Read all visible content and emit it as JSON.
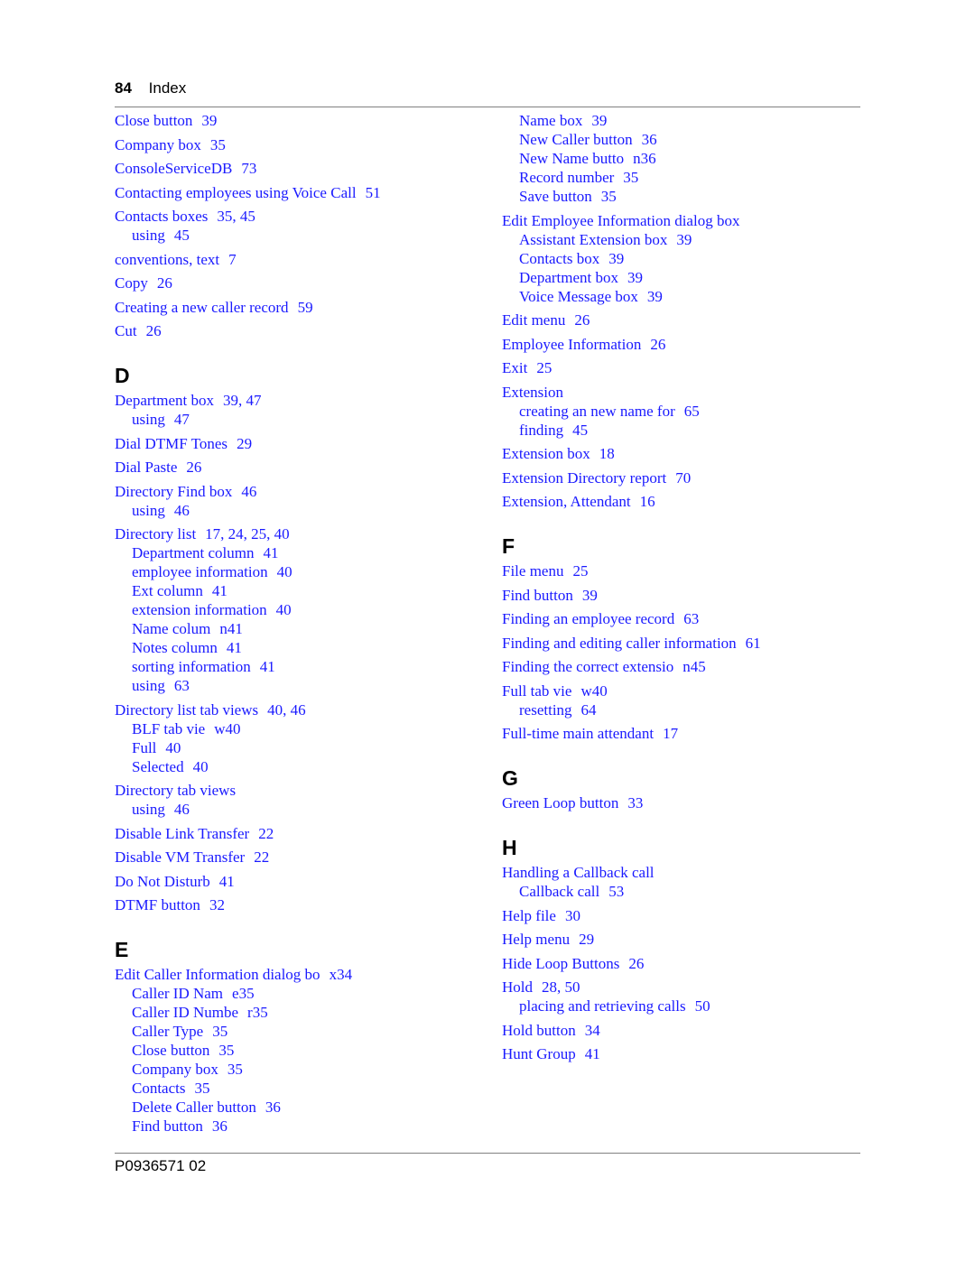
{
  "header": {
    "page_number": "84",
    "section": "Index"
  },
  "footer": {
    "doc_id": "P0936571 02"
  },
  "left_column": [
    {
      "type": "entry",
      "term": "Close button",
      "pages": "39"
    },
    {
      "type": "entry",
      "term": "Company box",
      "pages": "35"
    },
    {
      "type": "entry",
      "term": "ConsoleServiceDB",
      "pages": "73"
    },
    {
      "type": "entry",
      "term": "Contacting employees using Voice Call",
      "pages": "51"
    },
    {
      "type": "entry",
      "term": "Contacts boxes",
      "pages": "35, 45",
      "subs": [
        {
          "term": "using",
          "pages": "45"
        }
      ]
    },
    {
      "type": "entry",
      "term": "conventions, text",
      "pages": "7"
    },
    {
      "type": "entry",
      "term": "Copy",
      "pages": "26"
    },
    {
      "type": "entry",
      "term": "Creating a new caller record",
      "pages": "59"
    },
    {
      "type": "entry",
      "term": "Cut",
      "pages": "26"
    },
    {
      "type": "letter",
      "label": "D"
    },
    {
      "type": "entry",
      "term": "Department box",
      "pages": "39, 47",
      "subs": [
        {
          "term": "using",
          "pages": "47"
        }
      ]
    },
    {
      "type": "entry",
      "term": "Dial DTMF Tones",
      "pages": "29"
    },
    {
      "type": "entry",
      "term": "Dial Paste",
      "pages": "26"
    },
    {
      "type": "entry",
      "term": "Directory Find box",
      "pages": "46",
      "subs": [
        {
          "term": "using",
          "pages": "46"
        }
      ]
    },
    {
      "type": "entry",
      "term": "Directory list",
      "pages": "17, 24, 25, 40",
      "subs": [
        {
          "term": "Department column",
          "pages": "41"
        },
        {
          "term": "employee information",
          "pages": "40"
        },
        {
          "term": "Ext column",
          "pages": "41"
        },
        {
          "term": "extension information",
          "pages": "40"
        },
        {
          "term": "Name colum",
          "pages": "n41"
        },
        {
          "term": "Notes column",
          "pages": "41"
        },
        {
          "term": "sorting information",
          "pages": "41"
        },
        {
          "term": "using",
          "pages": "63"
        }
      ]
    },
    {
      "type": "entry",
      "term": "Directory list tab views",
      "pages": "40, 46",
      "subs": [
        {
          "term": "BLF tab vie",
          "pages": "w40"
        },
        {
          "term": "Full",
          "pages": "40"
        },
        {
          "term": "Selected",
          "pages": "40"
        }
      ]
    },
    {
      "type": "entry",
      "term": "Directory tab views",
      "pages": "",
      "subs": [
        {
          "term": "using",
          "pages": "46"
        }
      ]
    },
    {
      "type": "entry",
      "term": "Disable Link Transfer",
      "pages": "22"
    },
    {
      "type": "entry",
      "term": "Disable VM Transfer",
      "pages": "22"
    },
    {
      "type": "entry",
      "term": "Do Not Disturb",
      "pages": "41"
    },
    {
      "type": "entry",
      "term": "DTMF button",
      "pages": "32"
    },
    {
      "type": "letter",
      "label": "E"
    },
    {
      "type": "entry",
      "term": "Edit Caller Information dialog bo",
      "pages": "x34",
      "subs": [
        {
          "term": "Caller ID Nam",
          "pages": "e35"
        },
        {
          "term": "Caller ID Numbe",
          "pages": "r35"
        },
        {
          "term": "Caller Type",
          "pages": "35"
        },
        {
          "term": "Close button",
          "pages": "35"
        },
        {
          "term": "Company box",
          "pages": "35"
        },
        {
          "term": "Contacts",
          "pages": "35"
        },
        {
          "term": "Delete Caller button",
          "pages": "36"
        },
        {
          "term": "Find button",
          "pages": "36"
        }
      ]
    }
  ],
  "right_column": [
    {
      "type": "continuation",
      "subs": [
        {
          "term": "Name box",
          "pages": "39"
        },
        {
          "term": "New Caller button",
          "pages": "36"
        },
        {
          "term": "New Name butto",
          "pages": "n36"
        },
        {
          "term": "Record number",
          "pages": "35"
        },
        {
          "term": "Save button",
          "pages": "35"
        }
      ]
    },
    {
      "type": "entry",
      "term": "Edit Employee Information dialog box",
      "pages": "",
      "subs": [
        {
          "term": "Assistant Extension box",
          "pages": "39"
        },
        {
          "term": "Contacts box",
          "pages": "39"
        },
        {
          "term": "Department box",
          "pages": "39"
        },
        {
          "term": "Voice Message box",
          "pages": "39"
        }
      ]
    },
    {
      "type": "entry",
      "term": "Edit menu",
      "pages": "26"
    },
    {
      "type": "entry",
      "term": "Employee Information",
      "pages": "26"
    },
    {
      "type": "entry",
      "term": "Exit",
      "pages": "25"
    },
    {
      "type": "entry",
      "term": "Extension",
      "pages": "",
      "subs": [
        {
          "term": "creating an new name for",
          "pages": "65"
        },
        {
          "term": "finding",
          "pages": "45"
        }
      ]
    },
    {
      "type": "entry",
      "term": "Extension box",
      "pages": "18"
    },
    {
      "type": "entry",
      "term": "Extension Directory report",
      "pages": "70"
    },
    {
      "type": "entry",
      "term": "Extension, Attendant",
      "pages": "16"
    },
    {
      "type": "letter",
      "label": "F"
    },
    {
      "type": "entry",
      "term": "File menu",
      "pages": "25"
    },
    {
      "type": "entry",
      "term": "Find button",
      "pages": "39"
    },
    {
      "type": "entry",
      "term": "Finding an employee record",
      "pages": "63"
    },
    {
      "type": "entry",
      "term": "Finding and editing caller information",
      "pages": "61"
    },
    {
      "type": "entry",
      "term": "Finding the correct extensio",
      "pages": "n45"
    },
    {
      "type": "entry",
      "term": "Full tab vie",
      "pages": "w40",
      "subs": [
        {
          "term": "resetting",
          "pages": "64"
        }
      ]
    },
    {
      "type": "entry",
      "term": "Full-time main attendant",
      "pages": "17"
    },
    {
      "type": "letter",
      "label": "G"
    },
    {
      "type": "entry",
      "term": "Green Loop button",
      "pages": "33"
    },
    {
      "type": "letter",
      "label": "H"
    },
    {
      "type": "entry",
      "term": "Handling a Callback call",
      "pages": "",
      "subs": [
        {
          "term": "Callback call",
          "pages": "53"
        }
      ]
    },
    {
      "type": "entry",
      "term": "Help file",
      "pages": "30"
    },
    {
      "type": "entry",
      "term": "Help menu",
      "pages": "29"
    },
    {
      "type": "entry",
      "term": "Hide Loop Buttons",
      "pages": "26"
    },
    {
      "type": "entry",
      "term": "Hold",
      "pages": "28, 50",
      "subs": [
        {
          "term": "placing and retrieving calls",
          "pages": "50"
        }
      ]
    },
    {
      "type": "entry",
      "term": "Hold button",
      "pages": "34"
    },
    {
      "type": "entry",
      "term": "Hunt Group",
      "pages": "41"
    }
  ]
}
